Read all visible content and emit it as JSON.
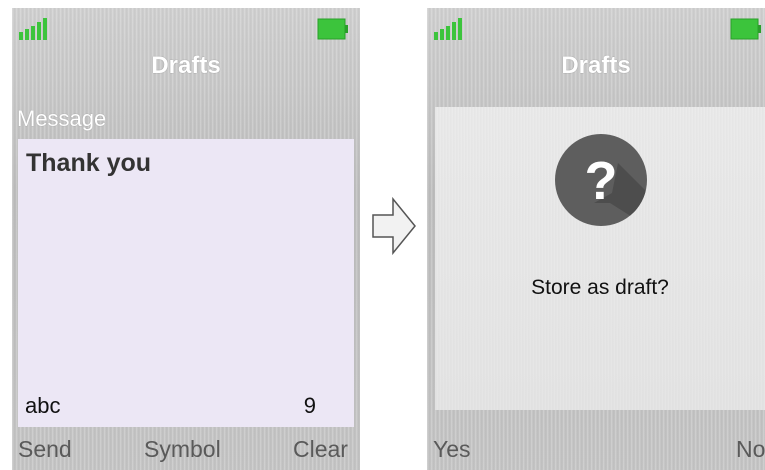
{
  "left_screen": {
    "title": "Drafts",
    "message_label": "Message",
    "message_text": "Thank you",
    "input_mode": "abc",
    "char_count": "9",
    "softkeys": {
      "left": "Send",
      "center": "Symbol",
      "right": "Clear"
    }
  },
  "right_screen": {
    "title": "Drafts",
    "dialog_text": "Store as draft?",
    "dialog_icon": "question-icon",
    "softkeys": {
      "left": "Yes",
      "right": "No"
    }
  },
  "icons": {
    "signal": "signal-strength-icon",
    "battery": "battery-icon",
    "transition": "arrow-right-icon"
  },
  "colors": {
    "status_green": "#3cc43c",
    "input_background": "#ece7f5",
    "question_icon": "#5e5e5e"
  }
}
